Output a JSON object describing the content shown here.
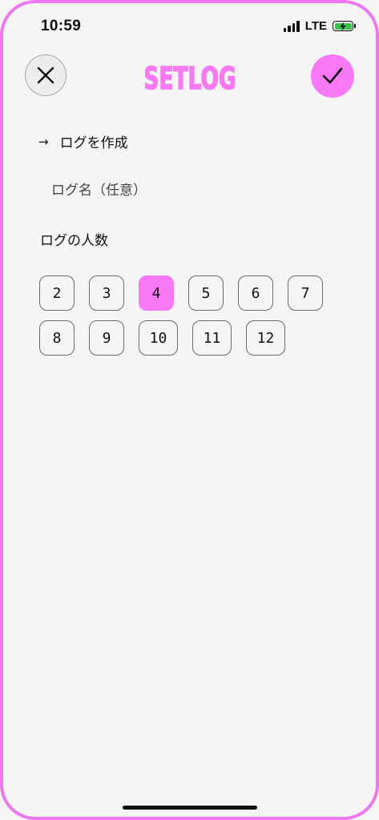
{
  "status_bar": {
    "time": "10:59",
    "network": "LTE",
    "battery_color": "#3ac14a"
  },
  "header": {
    "logo": "SETLOG",
    "close_icon": "close-icon",
    "confirm_icon": "checkmark-icon",
    "accent_color": "#f779f3"
  },
  "create": {
    "arrow": "→",
    "title": "ログを作成"
  },
  "log_name": {
    "value": "",
    "placeholder": "ログ名（任意）"
  },
  "players": {
    "label": "ログの人数",
    "options": [
      "2",
      "3",
      "4",
      "5",
      "6",
      "7",
      "8",
      "9",
      "10",
      "11",
      "12"
    ],
    "selected": "4"
  }
}
